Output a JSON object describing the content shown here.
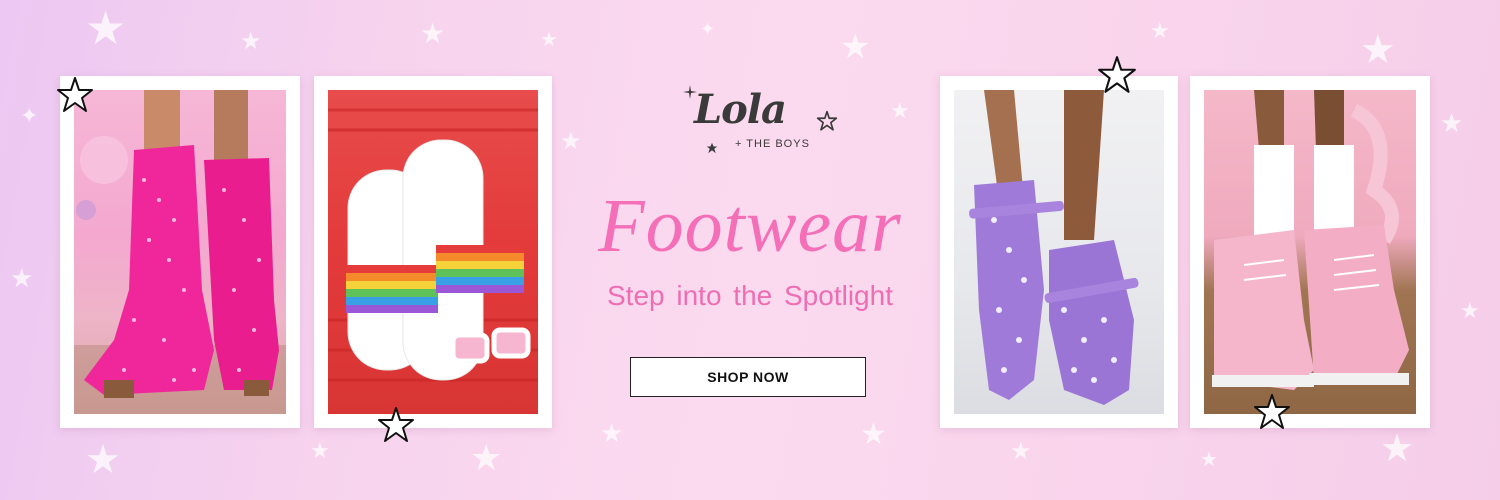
{
  "brand": {
    "logo_text": "Lola",
    "logo_subtext": "+ THE BOYS"
  },
  "hero": {
    "headline": "Footwear",
    "tagline": "Step into the Spotlight",
    "cta_label": "SHOP NOW"
  },
  "photos": [
    {
      "subject": "pink rhinestone cowboy boots"
    },
    {
      "subject": "rainbow bead slide sandals with white sunglasses"
    },
    {
      "subject": "lavender studded mary jane flats"
    },
    {
      "subject": "pink pearl lace-up boots with white socks and bow"
    }
  ],
  "colors": {
    "headline": "#f46fb8",
    "background": "#f7d3ee",
    "button_border": "#222222"
  },
  "icons": [
    "outline-star-icon",
    "sparkle-icon"
  ]
}
